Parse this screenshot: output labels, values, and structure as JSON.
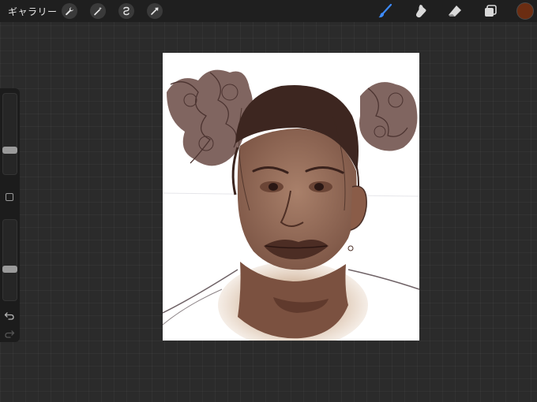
{
  "topbar": {
    "gallery_label": "ギャラリー",
    "tools_left": [
      {
        "icon": "wrench-icon"
      },
      {
        "icon": "magic-wand-icon"
      },
      {
        "icon": "selection-icon"
      },
      {
        "icon": "transform-arrow-icon"
      }
    ],
    "tools_right": [
      {
        "icon": "brush-icon",
        "active": true
      },
      {
        "icon": "smudge-icon"
      },
      {
        "icon": "eraser-icon"
      },
      {
        "icon": "layers-icon"
      }
    ],
    "current_color": "#6b2d12"
  },
  "sidebar": {
    "brush_size_level": 0.72,
    "opacity_level": 0.62
  },
  "colors": {
    "accent": "#3d8bff",
    "background": "#2b2b2b",
    "canvas": "#ffffff"
  }
}
